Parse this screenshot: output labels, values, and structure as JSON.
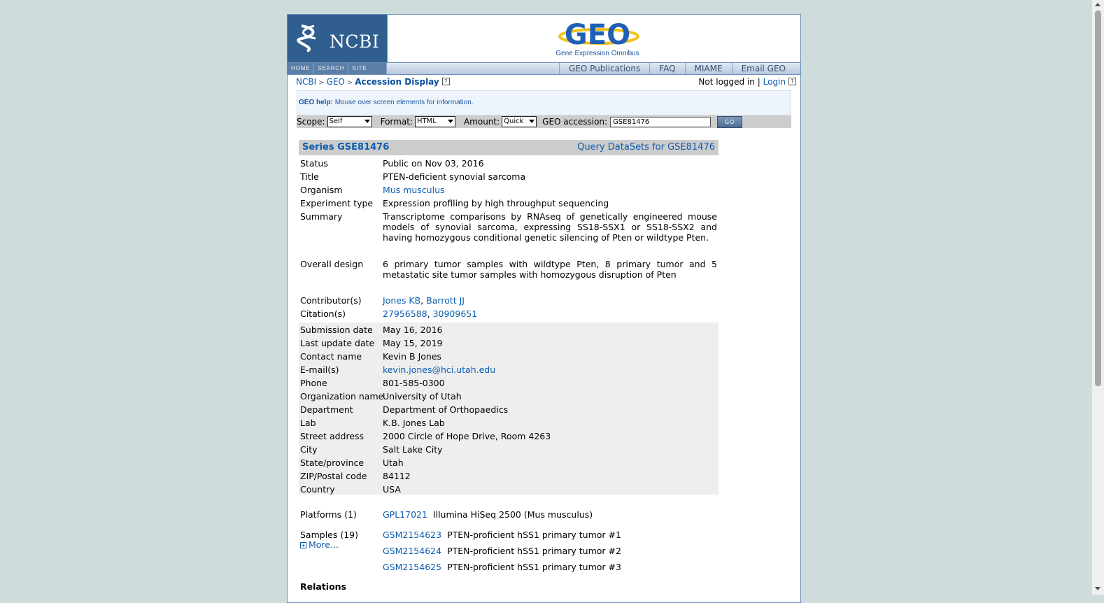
{
  "header": {
    "ncbi_label": "NCBI",
    "geo_logo_text": "GEO",
    "geo_subtitle": "Gene Expression Omnibus",
    "left_nav": [
      "HOME",
      "SEARCH",
      "SITE MAP"
    ],
    "right_nav": [
      "GEO Publications",
      "FAQ",
      "MIAME",
      "Email GEO"
    ]
  },
  "breadcrumb": {
    "items": [
      "NCBI",
      "GEO"
    ],
    "current": "Accession Display",
    "sep": ">"
  },
  "login": {
    "status": "Not logged in",
    "separator": "|",
    "login_link": "Login"
  },
  "help": {
    "label": "GEO help:",
    "text": "Mouse over screen elements for information."
  },
  "form": {
    "scope_label": "Scope:",
    "scope_value": "Self",
    "format_label": "Format:",
    "format_value": "HTML",
    "amount_label": "Amount:",
    "amount_value": "Quick",
    "accession_label": "GEO accession:",
    "accession_value": "GSE81476",
    "go_label": "GO"
  },
  "series": {
    "title": "Series GSE81476",
    "query_link": "Query DataSets for GSE81476",
    "status_label": "Status",
    "status": "Public on Nov 03, 2016",
    "title_label": "Title",
    "title_value": "PTEN-deficient synovial sarcoma",
    "organism_label": "Organism",
    "organism": "Mus musculus",
    "exptype_label": "Experiment type",
    "exptype": "Expression profiling by high throughput sequencing",
    "summary_label": "Summary",
    "summary": "Transcriptome comparisons by RNAseq of genetically engineered mouse models of synovial sarcoma, expressing SS18-SSX1 or SS18-SSX2 and having homozygous conditional genetic silencing of Pten or wildtype Pten.",
    "design_label": "Overall design",
    "design": "6 primary tumor samples with wildtype Pten, 8 primary tumor and 5 metastatic site tumor samples with homozygous disruption of Pten",
    "contributors_label": "Contributor(s)",
    "contributors": [
      "Jones KB",
      "Barrott JJ"
    ],
    "citations_label": "Citation(s)",
    "citations": [
      "27956588",
      "30909651"
    ],
    "list_sep": ", ",
    "contact": [
      {
        "k": "Submission date",
        "v": "May 16, 2016"
      },
      {
        "k": "Last update date",
        "v": "May 15, 2019"
      },
      {
        "k": "Contact name",
        "v": "Kevin B Jones"
      },
      {
        "k": "E-mail(s)",
        "v": "kevin.jones@hci.utah.edu"
      },
      {
        "k": "Phone",
        "v": "801-585-0300"
      },
      {
        "k": "Organization name",
        "v": "University of Utah"
      },
      {
        "k": "Department",
        "v": "Department of Orthopaedics"
      },
      {
        "k": "Lab",
        "v": "K.B. Jones Lab"
      },
      {
        "k": "Street address",
        "v": "2000 Circle of Hope Drive, Room 4263"
      },
      {
        "k": "City",
        "v": "Salt Lake City"
      },
      {
        "k": "State/province",
        "v": "Utah"
      },
      {
        "k": "ZIP/Postal code",
        "v": "84112"
      },
      {
        "k": "Country",
        "v": "USA"
      }
    ],
    "platforms_label": "Platforms (1)",
    "platform_id": "GPL17021",
    "platform_desc": "Illumina HiSeq 2500 (Mus musculus)",
    "samples_label": "Samples (19)",
    "more_label": "More...",
    "samples": [
      {
        "id": "GSM2154623",
        "desc": "PTEN-proficient hSS1 primary tumor #1"
      },
      {
        "id": "GSM2154624",
        "desc": "PTEN-proficient hSS1 primary tumor #2"
      },
      {
        "id": "GSM2154625",
        "desc": "PTEN-proficient hSS1 primary tumor #3"
      }
    ],
    "relations_label": "Relations"
  },
  "colors": {
    "link": "#0b5cb0",
    "page_bg": "#cfdcdc",
    "ncbi_blue": "#2f5e8f"
  }
}
